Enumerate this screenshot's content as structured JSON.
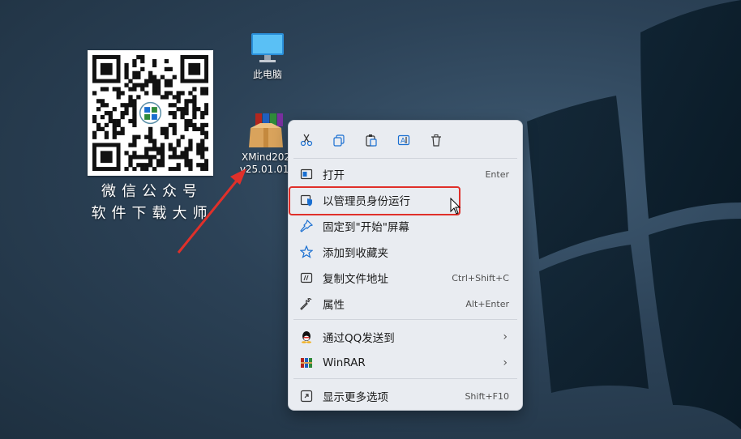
{
  "desktop": {
    "this_pc_label": "此电脑",
    "xmind_label_line1": "XMind202",
    "xmind_label_line2": "v25.01.01.",
    "qr_caption_line1": "微信公众号",
    "qr_caption_line2": "软件下载大师"
  },
  "context_menu": {
    "toolbar_icons": [
      "cut-icon",
      "copy-icon",
      "paste-icon",
      "rename-icon",
      "delete-icon"
    ],
    "items": [
      {
        "label": "打开",
        "shortcut": "Enter",
        "icon": "open-icon"
      },
      {
        "label": "以管理员身份运行",
        "shortcut": "",
        "icon": "shield-icon",
        "highlighted": true
      },
      {
        "label": "固定到\"开始\"屏幕",
        "shortcut": "",
        "icon": "pin-icon"
      },
      {
        "label": "添加到收藏夹",
        "shortcut": "",
        "icon": "star-icon"
      },
      {
        "label": "复制文件地址",
        "shortcut": "Ctrl+Shift+C",
        "icon": "copy-path-icon"
      },
      {
        "label": "属性",
        "shortcut": "Alt+Enter",
        "icon": "wrench-icon"
      },
      {
        "label": "通过QQ发送到",
        "shortcut": "",
        "icon": "qq-icon",
        "submenu": true
      },
      {
        "label": "WinRAR",
        "shortcut": "",
        "icon": "winrar-icon",
        "submenu": true
      },
      {
        "label": "显示更多选项",
        "shortcut": "Shift+F10",
        "icon": "more-options-icon"
      }
    ],
    "submenu_glyph": "›"
  },
  "colors": {
    "highlight_border": "#e0302a",
    "accent_blue": "#1a6fd1",
    "menu_background": "#e9ecf1"
  }
}
